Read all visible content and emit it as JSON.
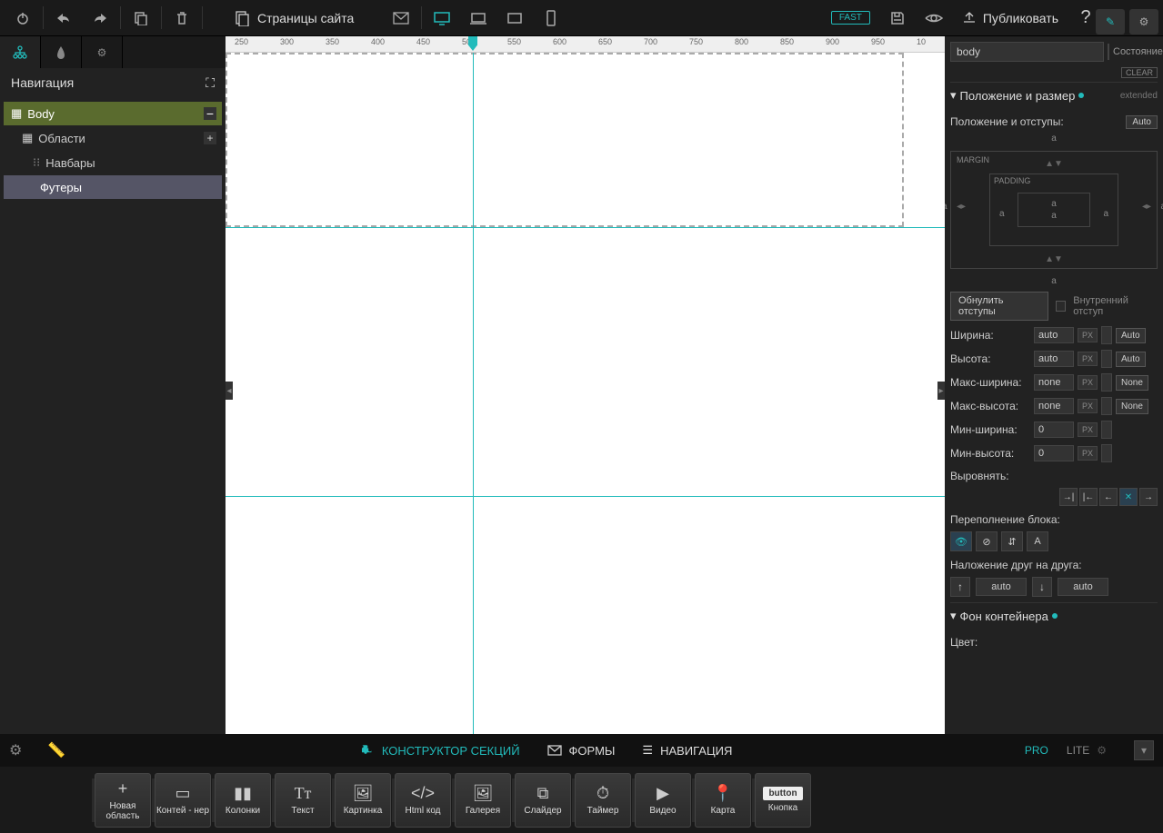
{
  "toolbar": {
    "pages": "Страницы сайта",
    "fast": "FAST",
    "publish": "Публиковать"
  },
  "left": {
    "nav_title": "Навигация",
    "body": "Body",
    "areas": "Области",
    "navbars": "Навбары",
    "footers": "Футеры"
  },
  "ruler": {
    "t250": "250",
    "t300": "300",
    "t350": "350",
    "t400": "400",
    "t450": "450",
    "t500": "500",
    "t550": "550",
    "t600": "600",
    "t650": "650",
    "t700": "700",
    "t750": "750",
    "t800": "800",
    "t850": "850",
    "t900": "900",
    "t950": "950",
    "t1000": "10"
  },
  "right": {
    "selector": "body",
    "state_label": "Состояние:",
    "clear": "CLEAR",
    "section_pos": "Положение и размер",
    "extended": "extended",
    "pos_label": "Положение и отступы:",
    "auto": "Auto",
    "margin": "MARGIN",
    "padding": "PADDING",
    "a": "a",
    "reset": "Обнулить отступы",
    "inner_pad": "Внутренний отступ",
    "width": "Ширина:",
    "height": "Высота:",
    "maxw": "Макс-ширина:",
    "maxh": "Макс-высота:",
    "minw": "Мин-ширина:",
    "minh": "Мин-высота:",
    "val_auto": "auto",
    "val_none": "none",
    "val_0": "0",
    "px": "PX",
    "none_btn": "None",
    "align": "Выровнять:",
    "overflow": "Переполнение блока:",
    "stacking": "Наложение друг на друга:",
    "section_bg": "Фон контейнера",
    "color": "Цвет:"
  },
  "bottom": {
    "constructor": "КОНСТРУКТОР СЕКЦИЙ",
    "forms": "ФОРМЫ",
    "navigation": "НАВИГАЦИЯ",
    "pro": "PRO",
    "lite": "LITE"
  },
  "widgets": {
    "area": "Новая область",
    "container": "Контей - нер",
    "columns": "Колонки",
    "text": "Текст",
    "image": "Картинка",
    "html": "Html код",
    "gallery": "Галерея",
    "slider": "Слайдер",
    "timer": "Таймер",
    "video": "Видео",
    "map": "Карта",
    "button_box": "button",
    "button": "Кнопка"
  }
}
